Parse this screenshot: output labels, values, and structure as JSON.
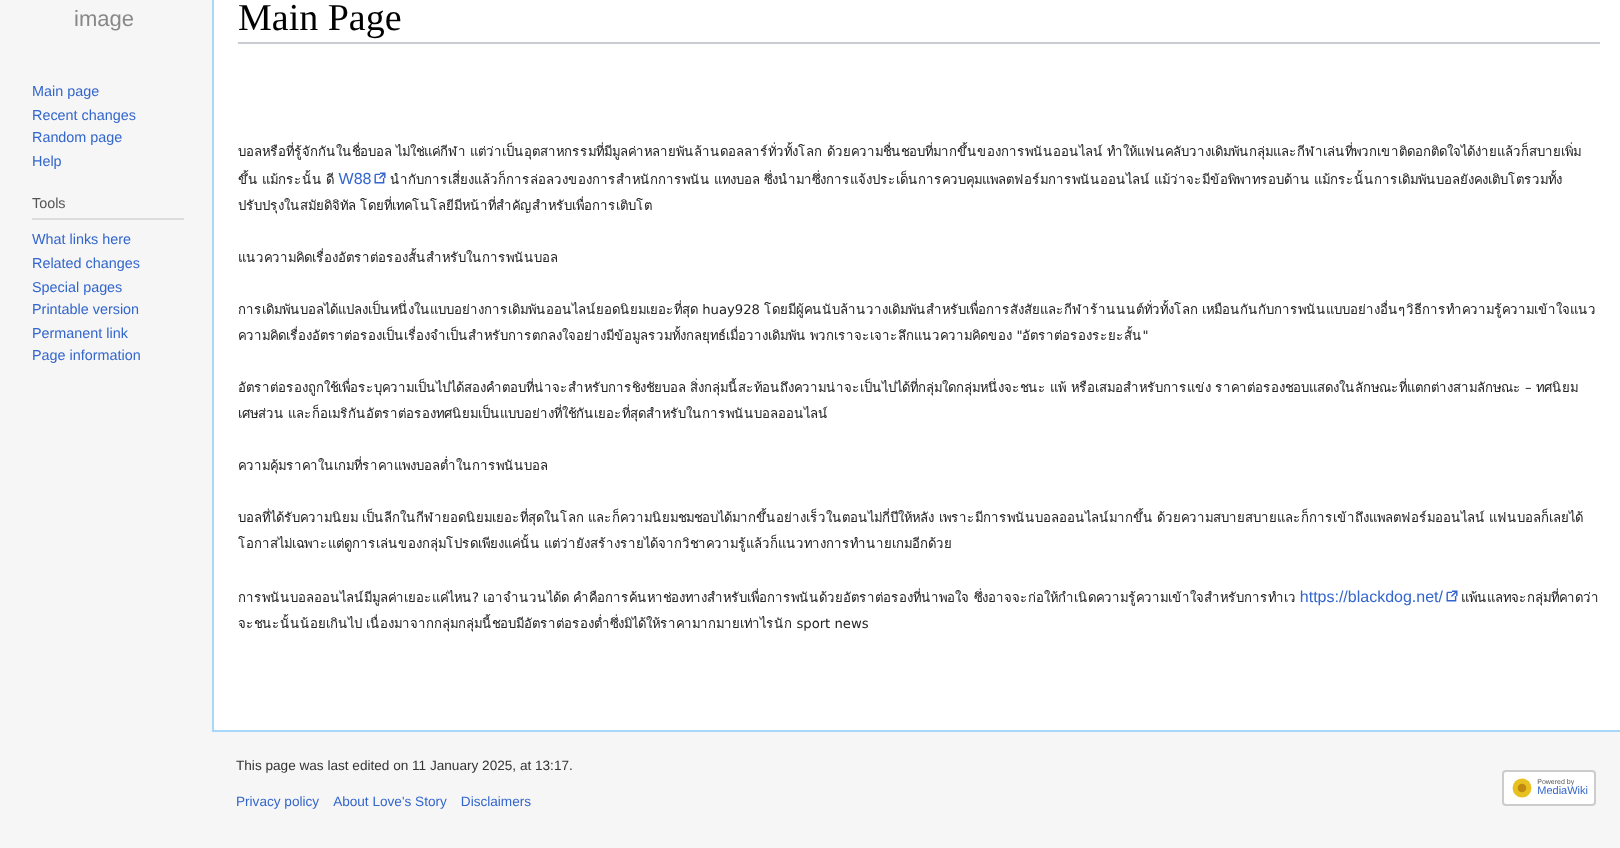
{
  "logo": {
    "caption": "image"
  },
  "sidebar": {
    "navigation": [
      "Main page",
      "Recent changes",
      "Random page",
      "Help"
    ],
    "tools": {
      "heading": "Tools",
      "items": [
        "What links here",
        "Related changes",
        "Special pages",
        "Printable version",
        "Permanent link",
        "Page information"
      ]
    }
  },
  "page": {
    "title": "Main Page",
    "paragraphs": [
      [
        {
          "kind": "text",
          "text": "บอลหรือที่รู้จักกันในชื่อบอล ไม่ใช่แค่กีฬา แต่ว่าเป็นอุตสาหกรรมที่มีมูลค่าหลายพันล้านดอลลาร์ทั่วทั้งโลก ด้วยความชื่นชอบที่มากขึ้นของการพนันออนไลน์ ทำให้แฟนคลับวางเดิมพันกลุ่มและกีฬาเล่นที่พวกเขาติดอกติดใจได้ง่ายแล้วก็สบายเพิ่มขึ้น แม้กระนั้น ดี "
        },
        {
          "kind": "link",
          "text": "W88"
        },
        {
          "kind": "text",
          "text": " นำกับการเสี่ยงแล้วก็การล่อลวงของการสำหนักการพนัน แทงบอล ซึ่งนำมาซึ่งการแจ้งประเด็นการควบคุมแพลตฟอร์มการพนันออนไลน์ แม้ว่าจะมีข้อพิพาทรอบด้าน แม้กระนั้นการเดิมพันบอลยังคงเติบโตรวมทั้งปรับปรุงในสมัยดิจิทัล โดยที่เทคโนโลยีมีหน้าที่สำคัญสำหรับเพื่อการเติบโต"
        }
      ],
      [
        {
          "kind": "text",
          "text": "แนวความคิดเรื่องอัตราต่อรองสั้นสำหรับในการพนันบอล"
        }
      ],
      [
        {
          "kind": "text",
          "text": "การเดิมพันบอลได้แปลงเป็นหนึ่งในแบบอย่างการเดิมพันออนไลน์ยอดนิยมเยอะที่สุด huay928 โดยมีผู้คนนับล้านวางเดิมพันสำหรับเพื่อการสังสัยและกีฬาร้านนนต์ทั่วทั้งโลก เหมือนกันกับการพนันแบบอย่างอื่นๆวิธีการทำความรู้ความเข้าใจแนวความคิดเรื่องอัตราต่อรองเป็นเรื่องจำเป็นสำหรับการตกลงใจอย่างมีข้อมูลรวมทั้งกลยุทธ์เมื่อวางเดิมพัน พวกเราจะเจาะลึกแนวความคิดของ \"อัตราต่อรองระยะสั้น\""
        }
      ],
      [
        {
          "kind": "text",
          "text": "อัตราต่อรองถูกใช้เพื่อระบุความเป็นไปได้สองคำตอบที่น่าจะสำหรับการชิงชัยบอล สิ่งกลุ่มนี้สะท้อนถึงความน่าจะเป็นไปได้ที่กลุ่มใดกลุ่มหนึ่งจะชนะ แพ้ หรือเสมอสำหรับการแข่ง ราคาต่อรองชอบแสดงในลักษณะที่แตกต่างสามลักษณะ – ทศนิยม เศษส่วน และก็อเมริกันอัตราต่อรองทศนิยมเป็นแบบอย่างที่ใช้กันเยอะที่สุดสำหรับในการพนันบอลออนไลน์"
        }
      ],
      [
        {
          "kind": "text",
          "text": "ความคุ้มราคาในเกมที่ราคาแพงบอลต่ำในการพนันบอล"
        }
      ],
      [
        {
          "kind": "text",
          "text": "บอลที่ได้รับความนิยม เป็นลีกในกีฬายอดนิยมเยอะที่สุดในโลก และก็ความนิยมชมชอบได้มากขึ้นอย่างเร็วในตอนไม่กี่ปีให้หลัง เพราะมีการพนันบอลออนไลน์มากขึ้น ด้วยความสบายสบายและก็การเข้าถึงแพลตฟอร์มออนไลน์ แฟนบอลก็เลยได้โอกาสไม่เฉพาะแต่ดูการเล่นของกลุ่มโปรดเพียงแค่นั้น แต่ว่ายังสร้างรายได้จากวิชาความรู้แล้วก็แนวทางการทำนายเกมอีกด้วย"
        }
      ],
      [
        {
          "kind": "text",
          "text": "การพนันบอลออนไลน์มีมูลค่าเยอะแค่ไหน? เอาจำนวนได้ด คำคือการค้นหาช่องทางสำหรับเพื่อการพนันด้วยอัตราต่อรองที่น่าพอใจ ซึ่งอาจจะก่อให้กำเนิดความรู้ความเข้าใจสำหรับการทำเว "
        },
        {
          "kind": "link",
          "text": "https://blackdog.net/"
        },
        {
          "kind": "text",
          "text": " แพ้นแลทจะกลุ่มที่คาดว่าจะชนะนั้นน้อยเกินไป เนื่องมาจากกลุ่มกลุ่มนี้ชอบมีอัตราต่อรองต่ำซึ่งมิได้ให้ราคามากมายเท่าไรนัก sport news"
        }
      ]
    ]
  },
  "footer": {
    "last_edited": "This page was last edited on 11 January 2025, at 13:17.",
    "links": [
      "Privacy policy",
      "About Love's Story",
      "Disclaimers"
    ],
    "badge": {
      "line_1": "Powered by",
      "line_2": "MediaWiki"
    }
  }
}
